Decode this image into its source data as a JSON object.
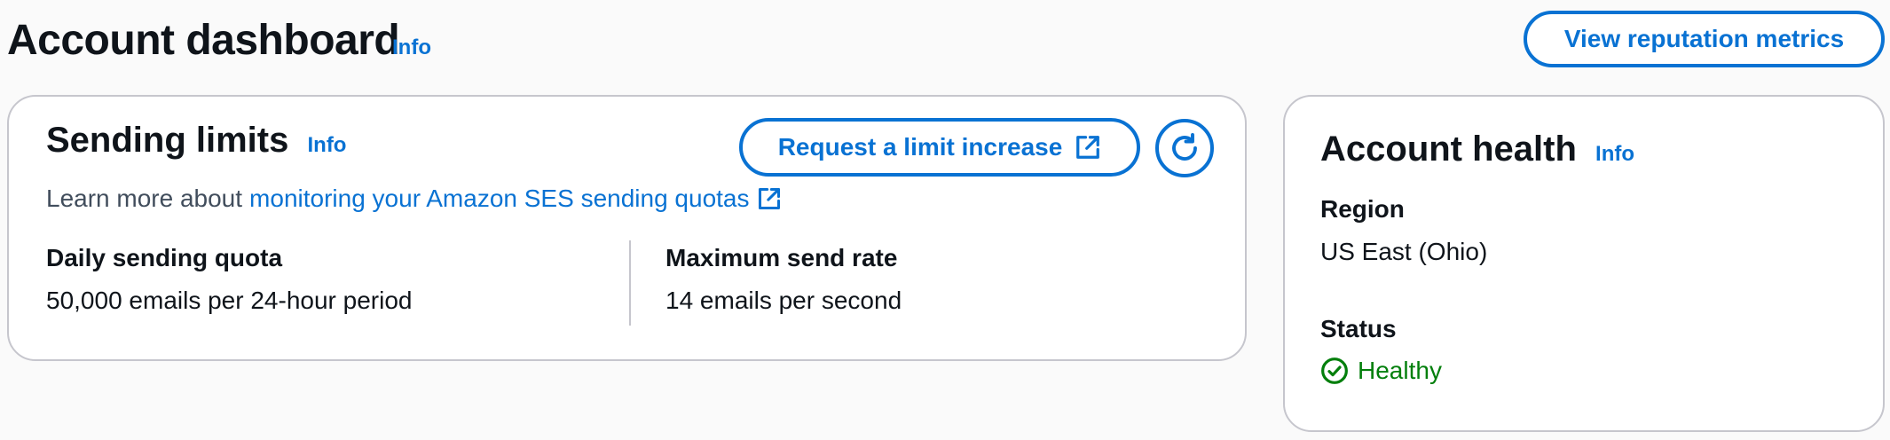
{
  "header": {
    "title": "Account dashboard",
    "info_label": "Info",
    "reputation_button": "View reputation metrics"
  },
  "sending_limits": {
    "title": "Sending limits",
    "info_label": "Info",
    "request_button": "Request a limit increase",
    "learn_more_prefix": "Learn more about",
    "learn_more_link": "monitoring your Amazon SES sending quotas",
    "daily_quota_label": "Daily sending quota",
    "daily_quota_value": "50,000 emails per 24-hour period",
    "max_rate_label": "Maximum send rate",
    "max_rate_value": "14 emails per second"
  },
  "account_health": {
    "title": "Account health",
    "info_label": "Info",
    "region_label": "Region",
    "region_value": "US East (Ohio)",
    "status_label": "Status",
    "status_value": "Healthy"
  },
  "icons": {
    "external_link": "external-link-icon",
    "refresh": "refresh-icon",
    "status_ok": "check-circle-icon"
  },
  "colors": {
    "link": "#0972d3",
    "healthy": "#037f0c",
    "border": "#c6c6cd",
    "text": "#0f141a",
    "secondary_text": "#414d5c"
  }
}
